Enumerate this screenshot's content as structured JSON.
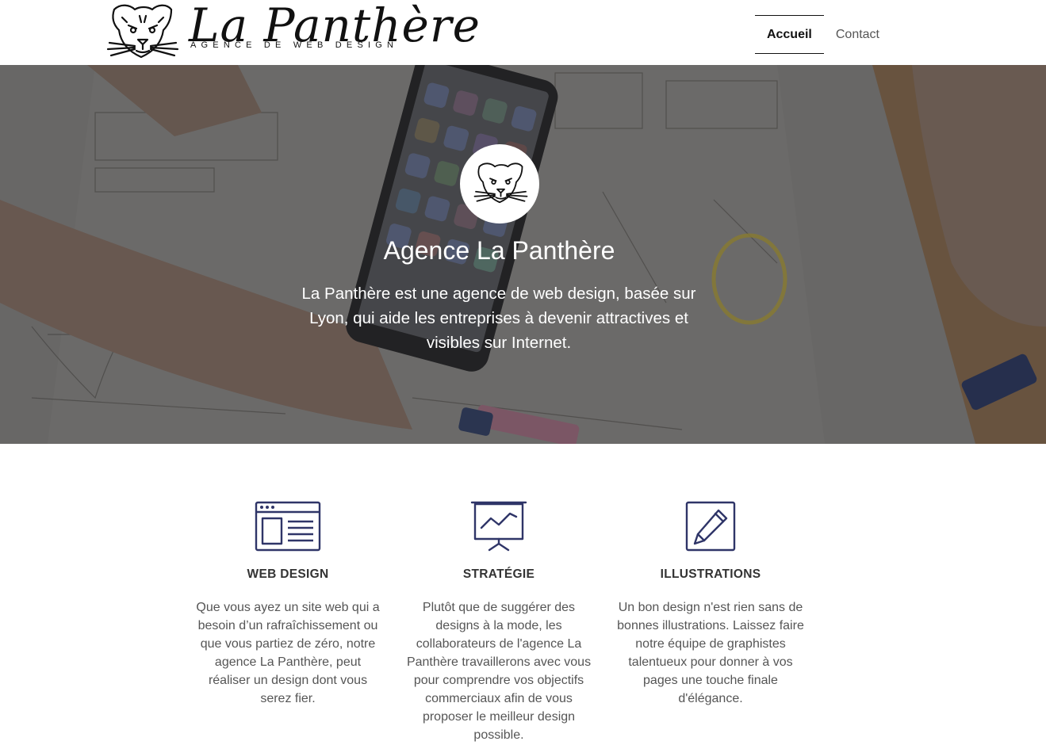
{
  "header": {
    "logo_title": "La Panthère",
    "logo_tagline": "AGENCE DE WEB DESIGN",
    "nav": [
      {
        "label": "Accueil",
        "active": true
      },
      {
        "label": "Contact",
        "active": false
      }
    ]
  },
  "hero": {
    "title": "Agence La Panthère",
    "text": "La Panthère est une agence de web design, basée sur Lyon, qui aide les entreprises à devenir attractives et visibles sur Internet."
  },
  "services": [
    {
      "icon": "web-layout-icon",
      "title": "WEB DESIGN",
      "text": "Que vous ayez un site web qui a besoin d’un rafraîchissement ou que vous partiez de zéro, notre agence La Panthère, peut réaliser un design dont vous serez fier."
    },
    {
      "icon": "presentation-chart-icon",
      "title": "STRATÉGIE",
      "text": "Plutôt que de suggérer des designs à la mode, les collaborateurs de l'agence La Panthère travaillerons avec vous pour comprendre vos objectifs commerciaux afin de vous proposer le meilleur design possible."
    },
    {
      "icon": "pencil-square-icon",
      "title": "ILLUSTRATIONS",
      "text": "Un bon design n'est rien sans de bonnes illustrations. Laissez faire notre équipe de graphistes talentueux pour donner à vos pages une touche finale d'élégance."
    }
  ],
  "colors": {
    "icon_stroke": "#2f3568",
    "text": "#555555",
    "heading": "#333333",
    "hero_text": "#ffffff"
  }
}
